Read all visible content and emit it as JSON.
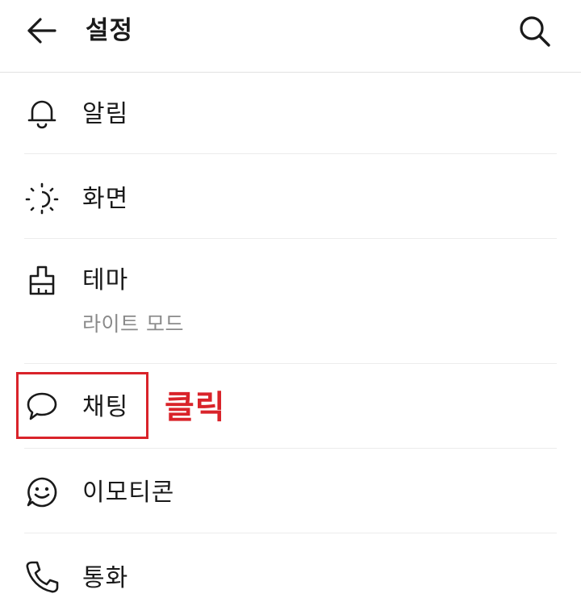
{
  "header": {
    "title": "설정",
    "back_icon": "arrow-left-icon",
    "search_icon": "search-icon"
  },
  "settings": {
    "items": [
      {
        "label": "알림",
        "icon": "bell-icon"
      },
      {
        "label": "화면",
        "icon": "brightness-icon"
      },
      {
        "label": "테마",
        "sub": "라이트 모드",
        "icon": "paint-brush-icon"
      },
      {
        "label": "채팅",
        "icon": "chat-bubble-icon"
      },
      {
        "label": "이모티콘",
        "icon": "smiley-icon"
      },
      {
        "label": "통화",
        "icon": "phone-icon"
      }
    ]
  },
  "annotation": {
    "text": "클릭",
    "color": "#d9232a"
  }
}
